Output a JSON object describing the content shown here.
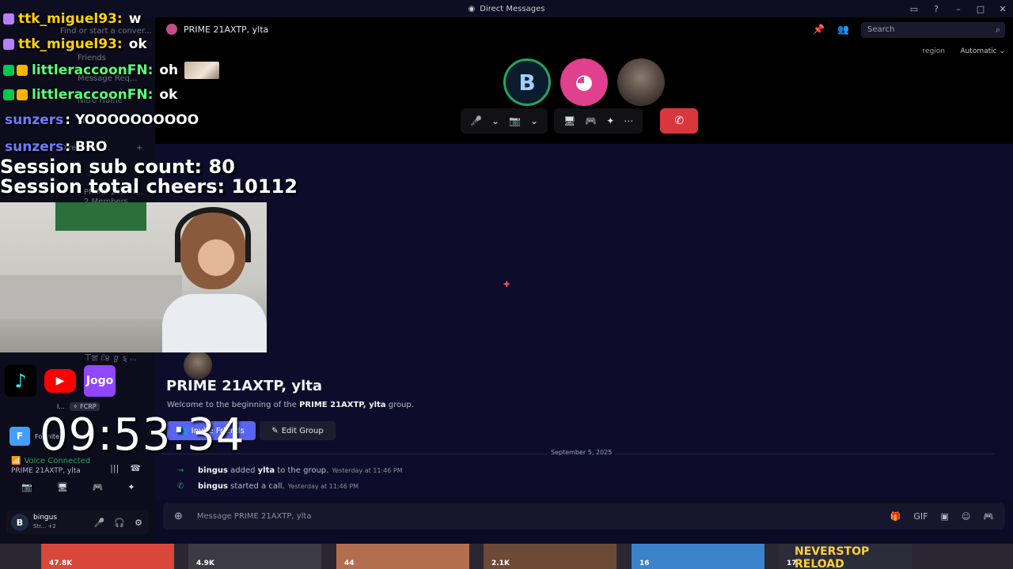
{
  "window": {
    "title": "Direct Messages"
  },
  "sidebar_ghost": {
    "find_placeholder": "Find or start a conver...",
    "friends": "Friends",
    "message_requests": "Message Req...",
    "nitro_home": "Nitro Home",
    "shop": "Sh",
    "direct_messages": "Direct Mes...",
    "group_entry": "PRIME 21AXT...",
    "group_members": "2 Members",
    "signature": "ㄒਗ਼ ℰ੪ ℊ ȿ ..."
  },
  "header": {
    "dm_title": "PRIME 21AXTP, ylta",
    "search_placeholder": "Search",
    "region_label": "region",
    "region_value": "Automatic"
  },
  "call": {
    "avatar1_letter": "B",
    "controls": {
      "mic": "🎤",
      "video": "📷",
      "screen": "🖥",
      "activity": "🎮",
      "soundboard": "✦",
      "more": "⋯",
      "end": "✆"
    }
  },
  "welcome": {
    "title": "PRIME 21AXTP, ylta",
    "text_prefix": "Welcome to the beginning of the ",
    "text_bold": "PRIME 21AXTP, ylta",
    "text_suffix": " group.",
    "invite_button": "Invite Friends",
    "edit_button": "Edit Group"
  },
  "date_divider": "September 5, 2025",
  "system_messages": [
    {
      "actor": "bingus",
      "action": " added ",
      "target": "ylta",
      "rest": " to the group.",
      "timestamp": "Yesterday at 11:46 PM"
    },
    {
      "actor": "bingus",
      "action": " started a call.",
      "target": "",
      "rest": "",
      "timestamp": "Yesterday at 11:46 PM"
    }
  ],
  "composer": {
    "placeholder": "Message PRIME 21AXTP, ylta"
  },
  "voice": {
    "status": "Voice Connected",
    "channel": "PRIME 21AXTP, ylta"
  },
  "user": {
    "avatar_letter": "B",
    "name": "bingus",
    "status": "Str...",
    "extra": "+2"
  },
  "fcrp": {
    "name": "l...",
    "tag": "✧ FCRP"
  },
  "ftile": "F",
  "ftile_label": "Fortnite",
  "stream_chat": [
    {
      "user": "ttk_miguel93:",
      "message": "w",
      "color": "#ffd400"
    },
    {
      "user": "ttk_miguel93:",
      "message": "ok",
      "color": "#ffd400"
    },
    {
      "user": "littleraccoonFN:",
      "message": "oh",
      "color": "#5dff7a"
    },
    {
      "user": "littleraccoonFN:",
      "message": "ok",
      "color": "#5dff7a"
    },
    {
      "user": "sunzers",
      "message": ": YOOOOOOOOOO",
      "color": "#6f7dff"
    },
    {
      "user": "sunzers",
      "message": ": BRO",
      "color": "#6f7dff"
    }
  ],
  "session": {
    "subs": "Session sub count: 80",
    "cheers": "Session total cheers: 10112"
  },
  "socials": {
    "youtube": "▶",
    "twitch": "Jogo"
  },
  "timer": "09:53:34",
  "thumbs": [
    {
      "count": "47.8K",
      "title": ""
    },
    {
      "count": "4.9K",
      "title": ""
    },
    {
      "count": "44",
      "title": ""
    },
    {
      "count": "2.1K",
      "title": ""
    },
    {
      "count": "16",
      "title": ""
    },
    {
      "count": "17",
      "title": "NEVERSTOP RELOAD"
    }
  ],
  "thumb_colors": [
    "#d8473a",
    "#3c3b43",
    "#b26e4e",
    "#6c4a36",
    "#3a82c9",
    "#2b2d3b"
  ],
  "accent_colors": {
    "primary": "#5865f2",
    "danger": "#da373c",
    "online": "#23a55a"
  }
}
